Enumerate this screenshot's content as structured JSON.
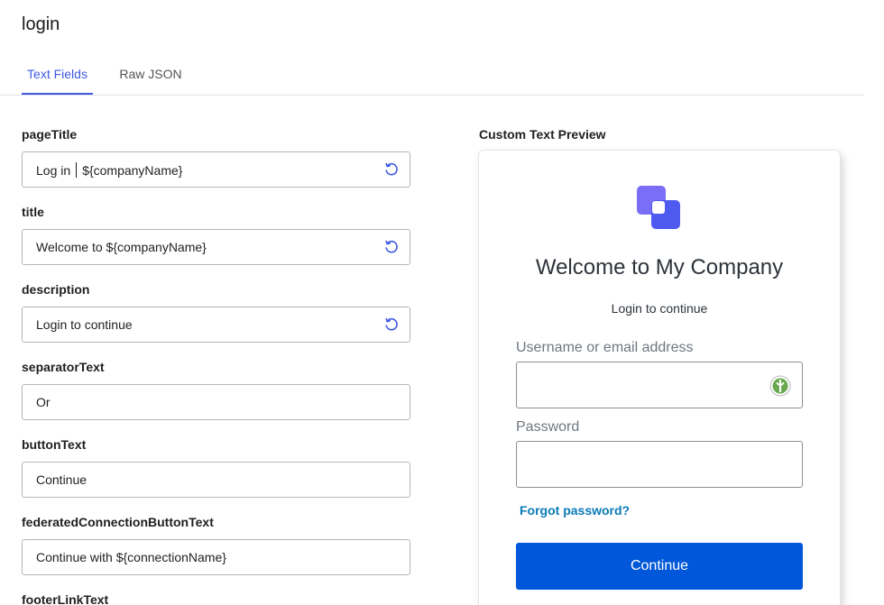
{
  "header": {
    "title": "login"
  },
  "tabs": [
    {
      "label": "Text Fields",
      "active": true
    },
    {
      "label": "Raw JSON",
      "active": false
    }
  ],
  "fields": {
    "pageTitle": {
      "label": "pageTitle",
      "value_before_caret": "Log in",
      "value_after_caret": "${companyName}"
    },
    "title": {
      "label": "title",
      "value": "Welcome to ${companyName}"
    },
    "description": {
      "label": "description",
      "value": "Login to continue"
    },
    "separatorText": {
      "label": "separatorText",
      "value": "Or"
    },
    "buttonText": {
      "label": "buttonText",
      "value": "Continue"
    },
    "federatedConnectionButtonText": {
      "label": "federatedConnectionButtonText",
      "value": "Continue with ${connectionName}"
    },
    "footerLinkText": {
      "label": "footerLinkText"
    }
  },
  "preview": {
    "heading": "Custom Text Preview",
    "title": "Welcome to My Company",
    "description": "Login to continue",
    "username_label": "Username or email address",
    "password_label": "Password",
    "forgot_link": "Forgot password?",
    "button": "Continue"
  },
  "colors": {
    "accent": "#3f59e4",
    "button": "#0057d9",
    "link": "#0a7bb8",
    "logo_primary": "#4f5bf0",
    "logo_secondary": "#7b6ef6"
  },
  "icons": {
    "reset": "reset-icon",
    "logo": "company-logo",
    "password_manager": "password-manager-icon"
  }
}
